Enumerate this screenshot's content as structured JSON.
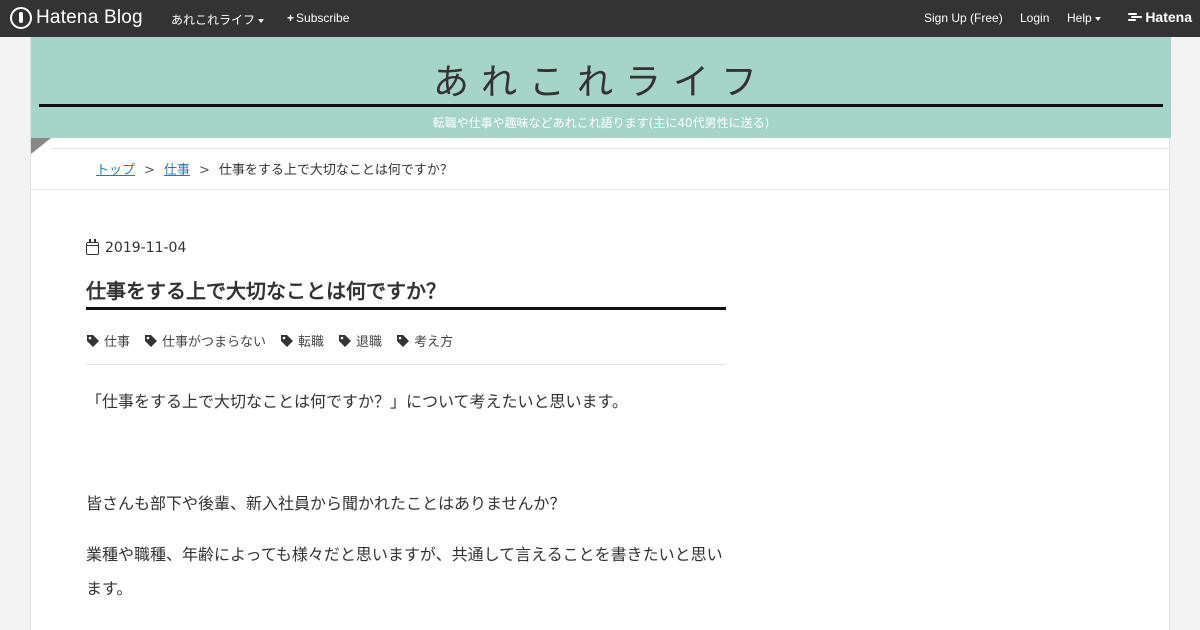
{
  "topbar": {
    "logo_text": "Hatena Blog",
    "blog_menu": "あれこれライフ",
    "subscribe": "Subscribe",
    "signup": "Sign Up (Free)",
    "login": "Login",
    "help": "Help",
    "hatena": "Hatena"
  },
  "blog": {
    "title": "あれこれライフ",
    "description": "転職や仕事や趣味などあれこれ語ります(主に40代男性に送る)",
    "header_color": "#a6d4c9"
  },
  "breadcrumb": {
    "top": "トップ",
    "category": "仕事",
    "current": "仕事をする上で大切なことは何ですか？",
    "separator": ">"
  },
  "entry": {
    "date": "2019-11-04",
    "title": "仕事をする上で大切なことは何ですか？",
    "tags": [
      "仕事",
      "仕事がつまらない",
      "転職",
      "退職",
      "考え方"
    ],
    "paragraphs": [
      "「仕事をする上で大切なことは何ですか？」について考えたいと思います。",
      "皆さんも部下や後輩、新入社員から聞かれたことはありませんか？",
      "業種や職種、年齢によっても様々だと思いますが、共通して言えることを書きたいと思います。"
    ]
  }
}
